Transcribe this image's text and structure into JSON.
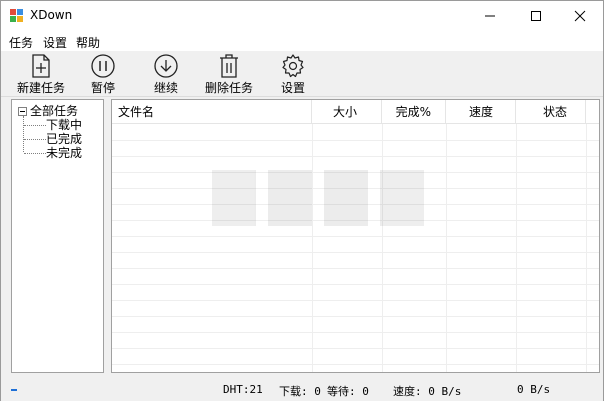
{
  "window": {
    "title": "XDown",
    "controls": {
      "minimize": "minimize",
      "maximize": "maximize",
      "close": "close"
    }
  },
  "menu": {
    "items": [
      {
        "label": "任务"
      },
      {
        "label": "设置"
      },
      {
        "label": "帮助"
      }
    ]
  },
  "toolbar": {
    "new_task": "新建任务",
    "pause": "暂停",
    "resume": "继续",
    "delete_task": "删除任务",
    "settings": "设置"
  },
  "tree": {
    "root": "全部任务",
    "children": [
      {
        "label": "下载中"
      },
      {
        "label": "已完成"
      },
      {
        "label": "未完成"
      }
    ]
  },
  "task_list": {
    "columns": [
      {
        "label": "文件名"
      },
      {
        "label": "大小"
      },
      {
        "label": "完成%"
      },
      {
        "label": "速度"
      },
      {
        "label": "状态"
      }
    ]
  },
  "status": {
    "dht": "DHT:21",
    "downloading": "下载: 0",
    "waiting": "等待: 0",
    "speed": "速度: 0 B/s",
    "speed2": "0 B/s"
  },
  "colors": {
    "accent": "#1e6fd6",
    "border": "#a0a0a0",
    "chrome": "#f0f0f0"
  }
}
